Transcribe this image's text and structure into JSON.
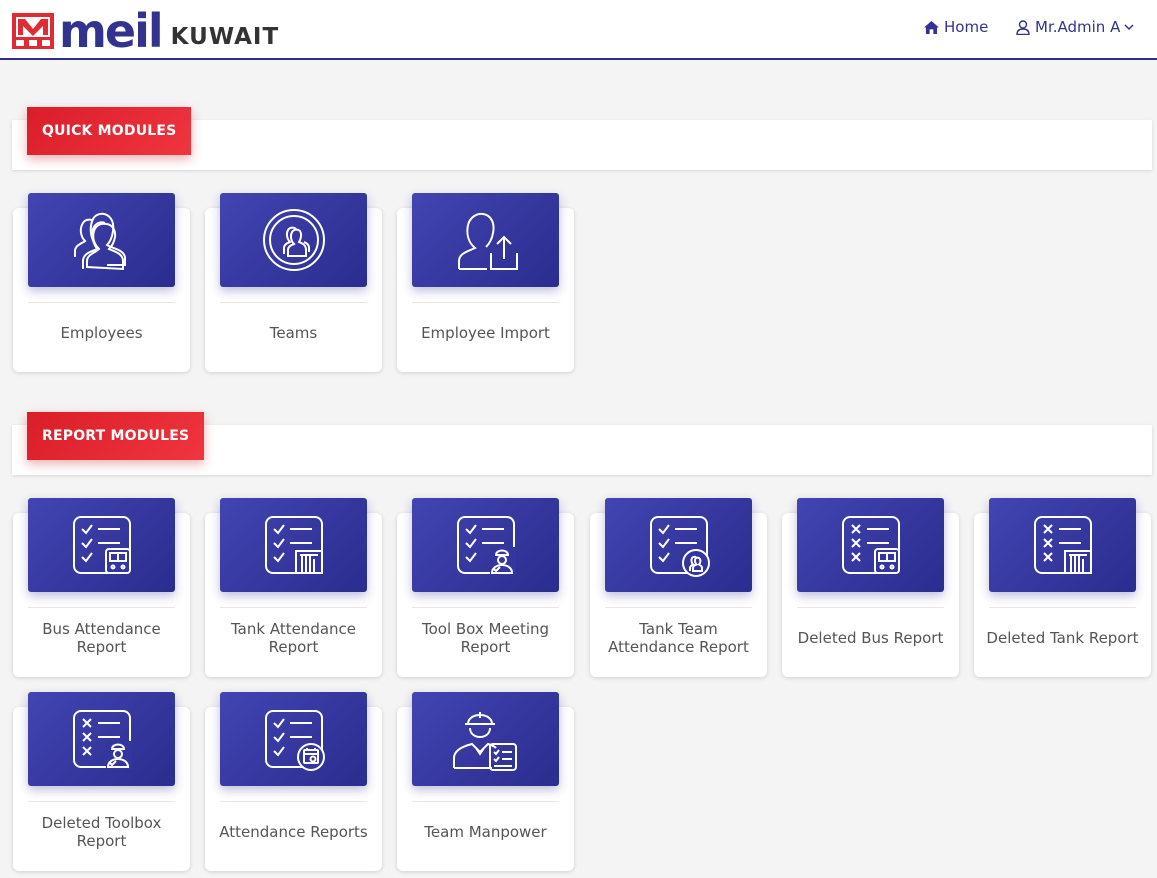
{
  "header": {
    "brand": "meil",
    "region": "KUWAIT",
    "home_label": "Home",
    "user_label": "Mr.Admin A",
    "colors": {
      "primary": "#33338f",
      "accent": "#e02b35"
    }
  },
  "quick_modules": {
    "title": "QUICK MODULES",
    "cards": [
      {
        "label": "Employees",
        "icon": "users-icon"
      },
      {
        "label": "Teams",
        "icon": "team-circle-icon"
      },
      {
        "label": "Employee Import",
        "icon": "user-import-icon"
      }
    ]
  },
  "report_modules": {
    "title": "REPORT MODULES",
    "cards": [
      {
        "label": "Bus Attendance Report",
        "icon": "bus-checklist-icon"
      },
      {
        "label": "Tank Attendance Report",
        "icon": "tank-checklist-icon"
      },
      {
        "label": "Tool Box Meeting Report",
        "icon": "worker-checklist-icon"
      },
      {
        "label": "Tank Team Attendance Report",
        "icon": "team-checklist-icon"
      },
      {
        "label": "Deleted Bus Report",
        "icon": "bus-deleted-checklist-icon"
      },
      {
        "label": "Deleted Tank Report",
        "icon": "tank-deleted-checklist-icon"
      },
      {
        "label": "Deleted Toolbox Report",
        "icon": "worker-deleted-checklist-icon"
      },
      {
        "label": "Attendance Reports",
        "icon": "calendar-checklist-icon"
      },
      {
        "label": "Team Manpower",
        "icon": "engineer-icon"
      }
    ]
  }
}
